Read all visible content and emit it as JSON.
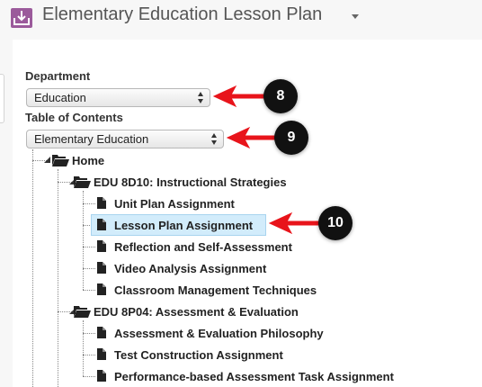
{
  "header": {
    "title": "Elementary Education Lesson Plan"
  },
  "department": {
    "label": "Department",
    "value": "Education"
  },
  "toc": {
    "label": "Table of Contents",
    "value": "Elementary Education"
  },
  "tree": {
    "root": "Home",
    "folders": [
      {
        "label": "EDU 8D10: Instructional Strategies",
        "items": [
          "Unit Plan Assignment",
          "Lesson Plan Assignment",
          "Reflection and Self-Assessment",
          "Video Analysis Assignment",
          "Classroom Management Techniques"
        ]
      },
      {
        "label": "EDU 8P04: Assessment & Evaluation",
        "items": [
          "Assessment & Evaluation Philosophy",
          "Test Construction Assignment",
          "Performance-based Assessment Task Assignment"
        ]
      }
    ],
    "selected_item": "Lesson Plan Assignment"
  },
  "callouts": {
    "department": "8",
    "toc": "9",
    "selected": "10"
  },
  "colors": {
    "callout_arrow": "#e8141b",
    "selection_bg": "#d2ecfb",
    "app_icon": "#9b5a9b"
  }
}
